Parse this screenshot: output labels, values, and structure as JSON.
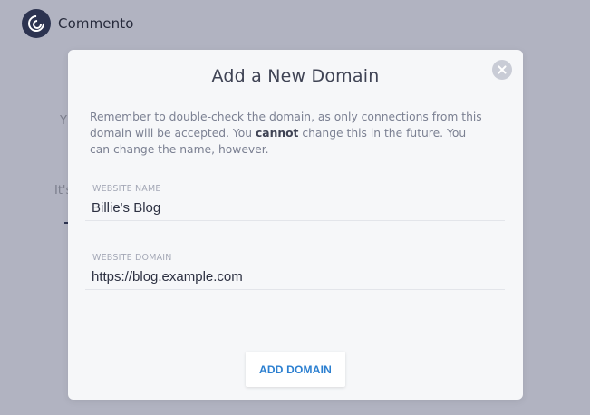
{
  "app": {
    "brand": "Commento",
    "logo_icon": "commento-logo-icon"
  },
  "background": {
    "fragment_1": "Y",
    "fragment_2": "It's"
  },
  "modal": {
    "title": "Add a New Domain",
    "close_icon": "close-icon",
    "notice_before": "Remember to double-check the domain, as only connections from this domain will be accepted. You ",
    "notice_emphasis": "cannot",
    "notice_after": " change this in the future. You can change the name, however.",
    "fields": {
      "website_name": {
        "label": "WEBSITE NAME",
        "value": "Billie's Blog"
      },
      "website_domain": {
        "label": "WEBSITE DOMAIN",
        "value": "https://blog.example.com"
      }
    },
    "add_button_label": "ADD DOMAIN"
  },
  "colors": {
    "overlay_bg": "#b1b3c1",
    "modal_bg": "#f6f7f9",
    "accent": "#2b7fd0",
    "logo": "#2c3350"
  }
}
